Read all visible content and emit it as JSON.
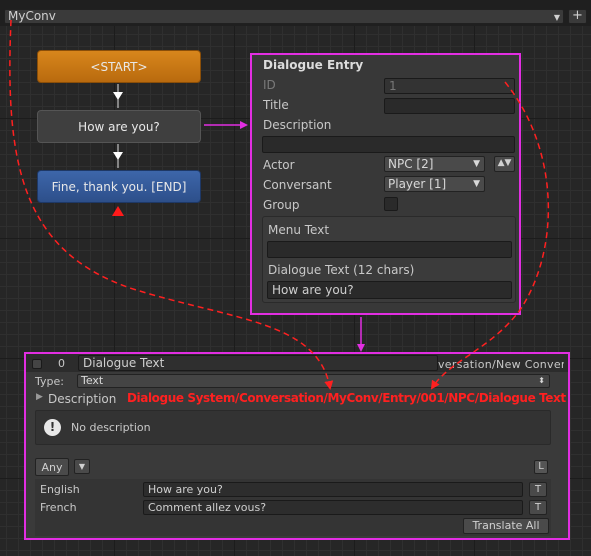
{
  "toolbar": {
    "conversation": "MyConv",
    "add_label": "+"
  },
  "nodes": {
    "start": "<START>",
    "how": "How are you?",
    "fine": "Fine, thank you. [END]"
  },
  "entry": {
    "title": "Dialogue Entry",
    "id_label": "ID",
    "id_value": "1",
    "title_label": "Title",
    "title_value": "",
    "description_label": "Description",
    "description_value": "",
    "actor_label": "Actor",
    "actor_value": "NPC [2]",
    "conversant_label": "Conversant",
    "conversant_value": "Player [1]",
    "group_label": "Group",
    "menu_text_label": "Menu Text",
    "menu_text_value": "",
    "dialogue_text_label": "Dialogue Text (12 chars)",
    "dialogue_text_value": "How are you?"
  },
  "inspector": {
    "index": "0",
    "field_name": "Dialogue Text",
    "path_fragment": "versation/New Conversa",
    "type_label": "Type:",
    "type_value": "Text",
    "description_label": "Description",
    "path_annotation": "Dialogue System/Conversation/MyConv/Entry/001/NPC/Dialogue Text",
    "no_description": "No description",
    "filter": "Any",
    "l_button": "L",
    "t_button": "T",
    "languages": [
      {
        "name": "English",
        "value": "How are you?"
      },
      {
        "name": "French",
        "value": "Comment allez vous?"
      }
    ],
    "translate_all": "Translate All"
  },
  "colors": {
    "annotation": "#e22ee2",
    "path_red": "#ff2020",
    "start_node": "#d8861c",
    "end_node": "#3d66aa"
  }
}
